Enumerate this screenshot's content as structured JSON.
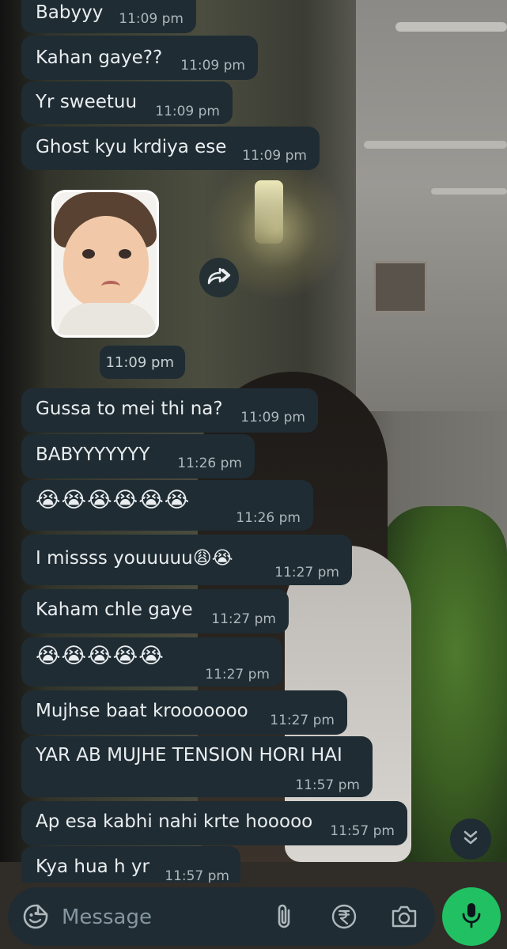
{
  "colors": {
    "bubble_bg": "#1f2c33",
    "text": "#e9edef",
    "timestamp": "#aeb7bc",
    "mic_button": "#21c063",
    "composer_bg": "#1f2c33",
    "placeholder": "#8696a0"
  },
  "messages": [
    {
      "text": "Babyyy",
      "time": "11:09 pm"
    },
    {
      "text": "Kahan gaye??",
      "time": "11:09 pm"
    },
    {
      "text": "Yr sweetuu",
      "time": "11:09 pm"
    },
    {
      "text": "Ghost kyu krdiya ese",
      "time": "11:09 pm"
    },
    {
      "type": "sticker",
      "sticker_icon": "crying-baby-sticker",
      "time": "11:09 pm"
    },
    {
      "text": "Gussa to mei thi na?",
      "time": "11:09 pm"
    },
    {
      "text": "BABYYYYYYY",
      "time": "11:26 pm"
    },
    {
      "text": "😭😭😭😭😭😭",
      "time": "11:26 pm"
    },
    {
      "text": "I missss youuuuu😩😭",
      "time": "11:27 pm"
    },
    {
      "text": "Kaham chle gaye",
      "time": "11:27 pm"
    },
    {
      "text": "😭😭😭😭😭",
      "time": "11:27 pm"
    },
    {
      "text": "Mujhse baat krooooooo",
      "time": "11:27 pm"
    },
    {
      "text": "YAR AB MUJHE TENSION HORI HAI",
      "time": "11:57 pm"
    },
    {
      "text": "Ap esa kabhi nahi krte hooooo",
      "time": "11:57 pm"
    },
    {
      "text": "Kya hua h yr",
      "time": "11:57 pm"
    }
  ],
  "composer": {
    "placeholder": "Message",
    "icons": [
      "emoji-icon",
      "attach-icon",
      "rupee-payment-icon",
      "camera-icon"
    ],
    "send_icon": "mic-icon"
  },
  "floating": {
    "forward_icon": "forward-icon",
    "scroll_icon": "double-chevron-down-icon"
  }
}
